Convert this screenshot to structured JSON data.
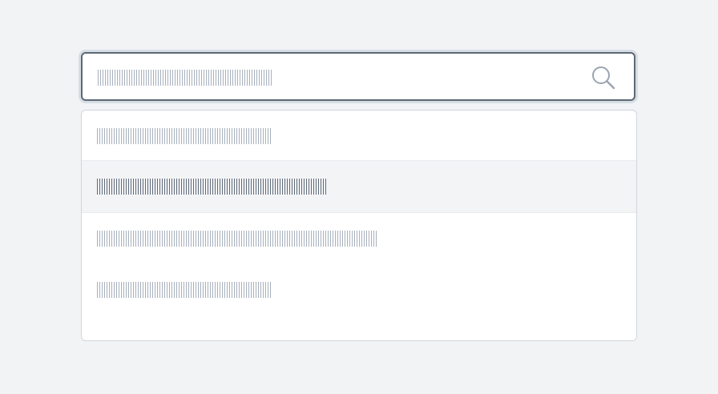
{
  "search": {
    "placeholder": "",
    "value": ""
  },
  "dropdown": {
    "options": [
      {
        "label": ""
      },
      {
        "label": "",
        "active": true
      },
      {
        "label": ""
      },
      {
        "label": ""
      }
    ]
  },
  "colors": {
    "background": "#f2f3f5",
    "input_border": "#5d6874",
    "focus_ring": "#d7dde5",
    "placeholder_text": "#a7b0bc",
    "active_option_text": "#5f6b78",
    "active_option_background": "#f3f4f6",
    "dropdown_border": "#d1d6dc"
  },
  "icons": {
    "search": "search-icon"
  }
}
